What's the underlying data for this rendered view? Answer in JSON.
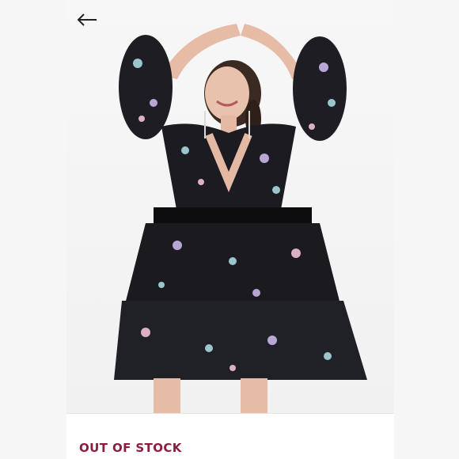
{
  "product": {
    "stock_status": "OUT OF STOCK"
  },
  "icons": {
    "back": "arrow-left-icon"
  },
  "colors": {
    "status_text": "#8b1e3f",
    "dress_base": "#1a1a1f"
  }
}
